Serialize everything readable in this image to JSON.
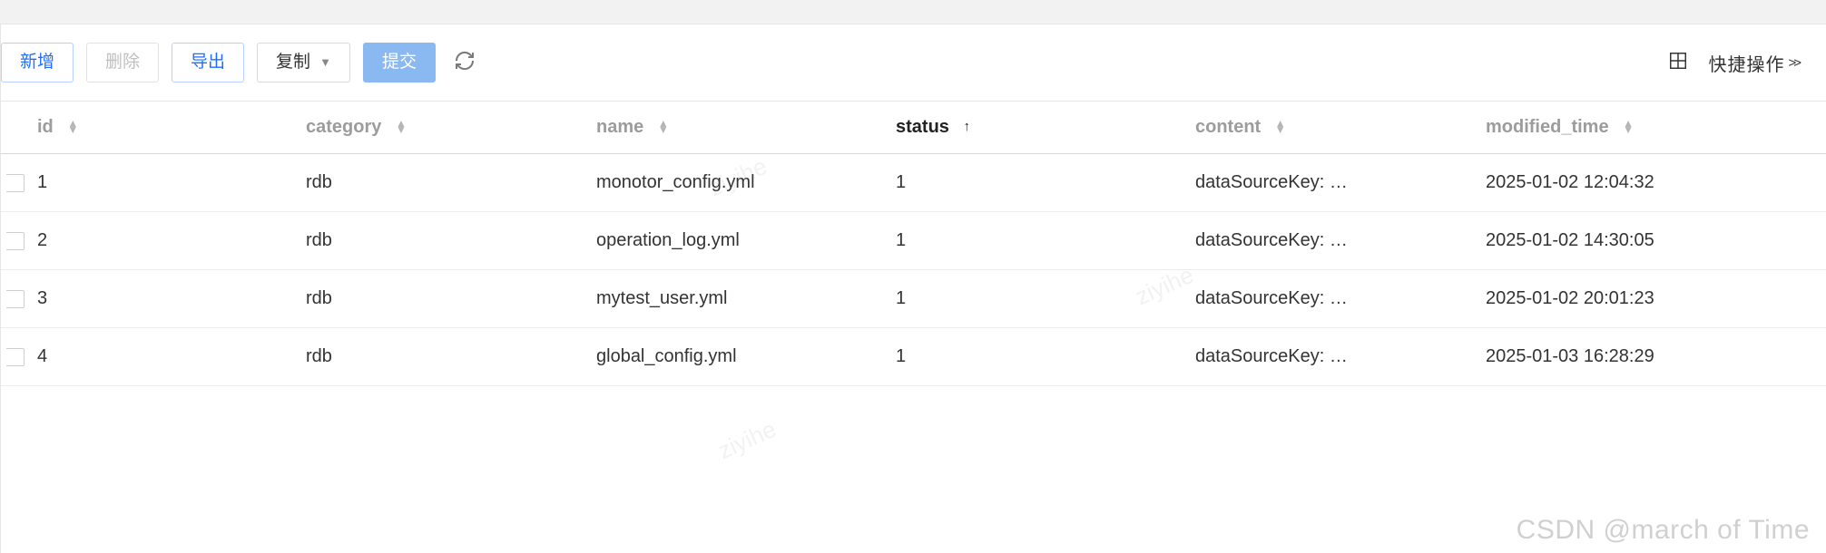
{
  "toolbar": {
    "add_label": "新增",
    "delete_label": "删除",
    "export_label": "导出",
    "copy_label": "复制",
    "submit_label": "提交",
    "quick_op_label": "快捷操作"
  },
  "table": {
    "columns": {
      "id": "id",
      "category": "category",
      "name": "name",
      "status": "status",
      "content": "content",
      "modified_time": "modified_time"
    },
    "rows": [
      {
        "id": "1",
        "category": "rdb",
        "name": "monotor_config.yml",
        "status": "1",
        "content": "dataSourceKey: …",
        "modified_time": "2025-01-02 12:04:32"
      },
      {
        "id": "2",
        "category": "rdb",
        "name": "operation_log.yml",
        "status": "1",
        "content": "dataSourceKey: …",
        "modified_time": "2025-01-02 14:30:05"
      },
      {
        "id": "3",
        "category": "rdb",
        "name": "mytest_user.yml",
        "status": "1",
        "content": "dataSourceKey: …",
        "modified_time": "2025-01-02 20:01:23"
      },
      {
        "id": "4",
        "category": "rdb",
        "name": "global_config.yml",
        "status": "1",
        "content": "dataSourceKey: …",
        "modified_time": "2025-01-03 16:28:29"
      }
    ]
  },
  "watermark": {
    "main": "CSDN @march of Time",
    "diag": "ziyihe"
  }
}
